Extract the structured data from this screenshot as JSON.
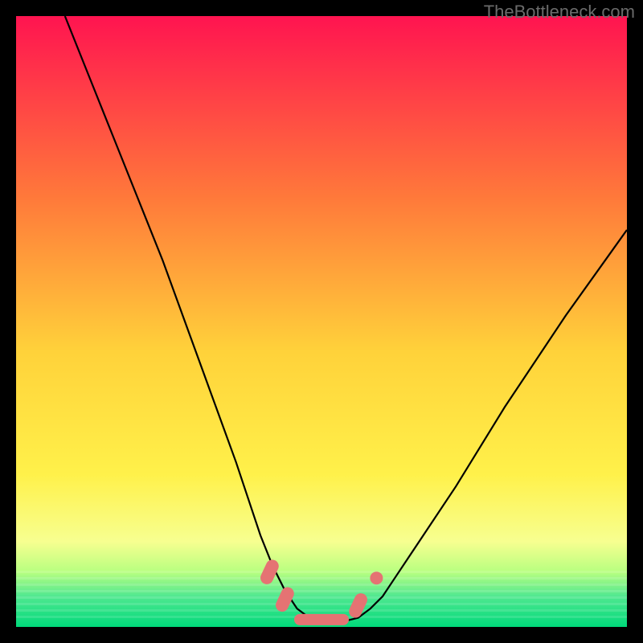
{
  "watermark": "TheBottleneck.com",
  "chart_data": {
    "type": "line",
    "title": "",
    "xlabel": "",
    "ylabel": "",
    "xlim": [
      0,
      100
    ],
    "ylim": [
      0,
      100
    ],
    "background": {
      "type": "vertical-gradient",
      "stops": [
        {
          "pos": 0,
          "color": "#ff1450"
        },
        {
          "pos": 30,
          "color": "#ff7a3a"
        },
        {
          "pos": 55,
          "color": "#ffd23a"
        },
        {
          "pos": 75,
          "color": "#fff14a"
        },
        {
          "pos": 86,
          "color": "#f7ff90"
        },
        {
          "pos": 91,
          "color": "#b8ff80"
        },
        {
          "pos": 95,
          "color": "#50e890"
        },
        {
          "pos": 100,
          "color": "#00d97a"
        }
      ]
    },
    "series": [
      {
        "name": "bottleneck-curve",
        "color": "#000000",
        "x": [
          8,
          12,
          16,
          20,
          24,
          28,
          32,
          36,
          40,
          42,
          44,
          46,
          48,
          50,
          52,
          54,
          56,
          58,
          60,
          62,
          66,
          72,
          80,
          90,
          100
        ],
        "y": [
          100,
          90,
          80,
          70,
          60,
          49,
          38,
          27,
          15,
          10,
          6,
          3,
          1.5,
          1,
          1,
          1,
          1.5,
          3,
          5,
          8,
          14,
          23,
          36,
          51,
          65
        ]
      }
    ],
    "markers": [
      {
        "name": "marker-1",
        "x": 41.5,
        "y": 9,
        "color": "#e57373",
        "shape": "capsule"
      },
      {
        "name": "marker-2",
        "x": 44,
        "y": 4.5,
        "color": "#e57373",
        "shape": "capsule"
      },
      {
        "name": "marker-3",
        "x": 50,
        "y": 1.2,
        "color": "#e57373",
        "shape": "capsule-horizontal"
      },
      {
        "name": "marker-4",
        "x": 56,
        "y": 3.5,
        "color": "#e57373",
        "shape": "capsule"
      },
      {
        "name": "marker-5",
        "x": 59,
        "y": 8,
        "color": "#e57373",
        "shape": "dot"
      }
    ]
  }
}
